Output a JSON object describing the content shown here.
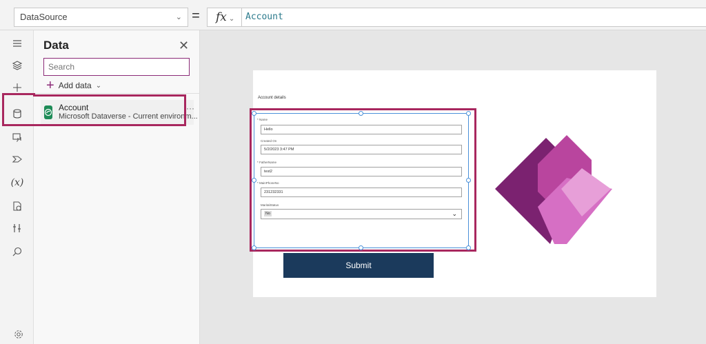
{
  "formula_bar": {
    "property": "DataSource",
    "equals": "=",
    "fx": "fx",
    "formula": "Account"
  },
  "rail": {
    "icons": [
      "menu-icon",
      "layers-icon",
      "plus-icon",
      "database-icon",
      "media-icon",
      "tag-icon",
      "variable-icon",
      "component-icon",
      "tools-icon",
      "search-icon",
      "settings-icon"
    ],
    "variable_label": "(x)"
  },
  "data_panel": {
    "title": "Data",
    "search_placeholder": "Search",
    "add_data_label": "Add data",
    "datasources": [
      {
        "name": "Account",
        "subtitle": "Microsoft Dataverse - Current environm..."
      }
    ]
  },
  "canvas": {
    "form_title": "Account details",
    "fields": [
      {
        "label": "Name",
        "required": true,
        "value": "Hello"
      },
      {
        "label": "Created On",
        "required": false,
        "value": "5/2/2023 3:47 PM"
      },
      {
        "label": "FatherName",
        "required": true,
        "value": "test2"
      },
      {
        "label": "MainPhoneNo",
        "required": true,
        "value": "231232331"
      }
    ],
    "marital_label": "MaritalStatus",
    "marital_value": "No",
    "submit_label": "Submit"
  },
  "colors": {
    "accent": "#a8275e",
    "submit": "#1b3a5c",
    "dataverse": "#1e8b57",
    "formula_text": "#2b7a8c"
  }
}
